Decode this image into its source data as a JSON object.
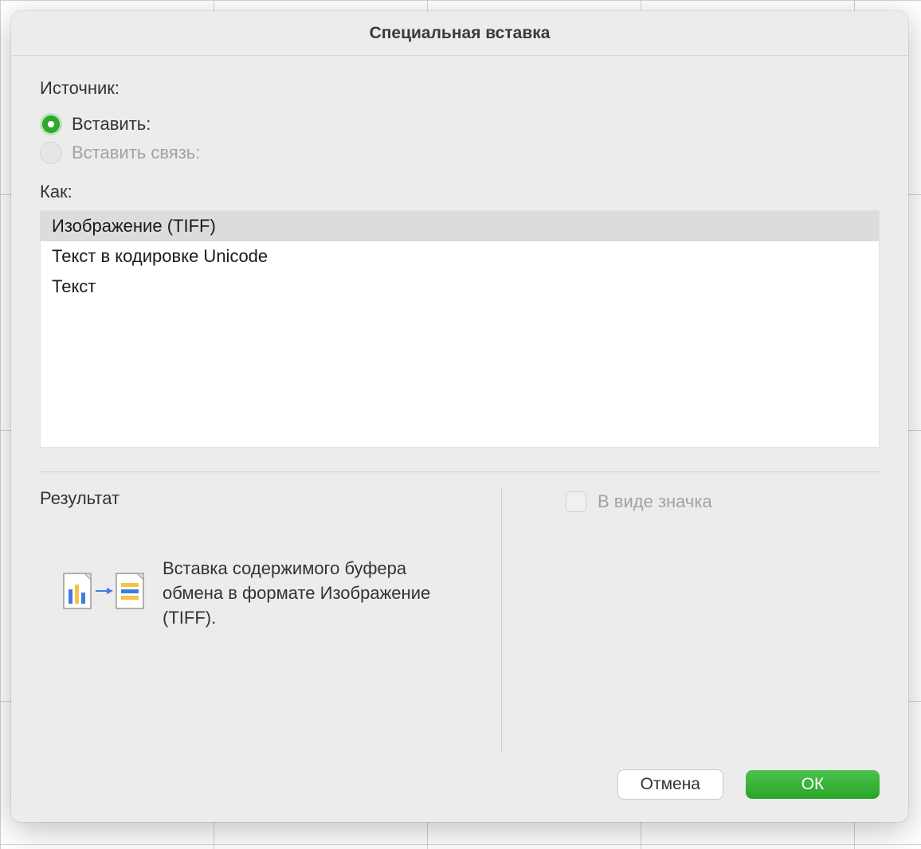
{
  "dialog": {
    "title": "Специальная вставка",
    "source_label": "Источник:",
    "radios": {
      "paste": {
        "label": "Вставить:",
        "selected": true
      },
      "paste_link": {
        "label": "Вставить связь:",
        "disabled": true
      }
    },
    "as_label": "Как:",
    "formats": [
      {
        "label": "Изображение (TIFF)",
        "selected": true
      },
      {
        "label": "Текст в кодировке Unicode",
        "selected": false
      },
      {
        "label": "Текст",
        "selected": false
      }
    ],
    "result_label": "Результат",
    "result_text": "Вставка содержимого буфера обмена в формате Изображение (TIFF).",
    "as_icon_label": "В виде значка",
    "buttons": {
      "cancel": "Отмена",
      "ok": "ОК"
    }
  }
}
